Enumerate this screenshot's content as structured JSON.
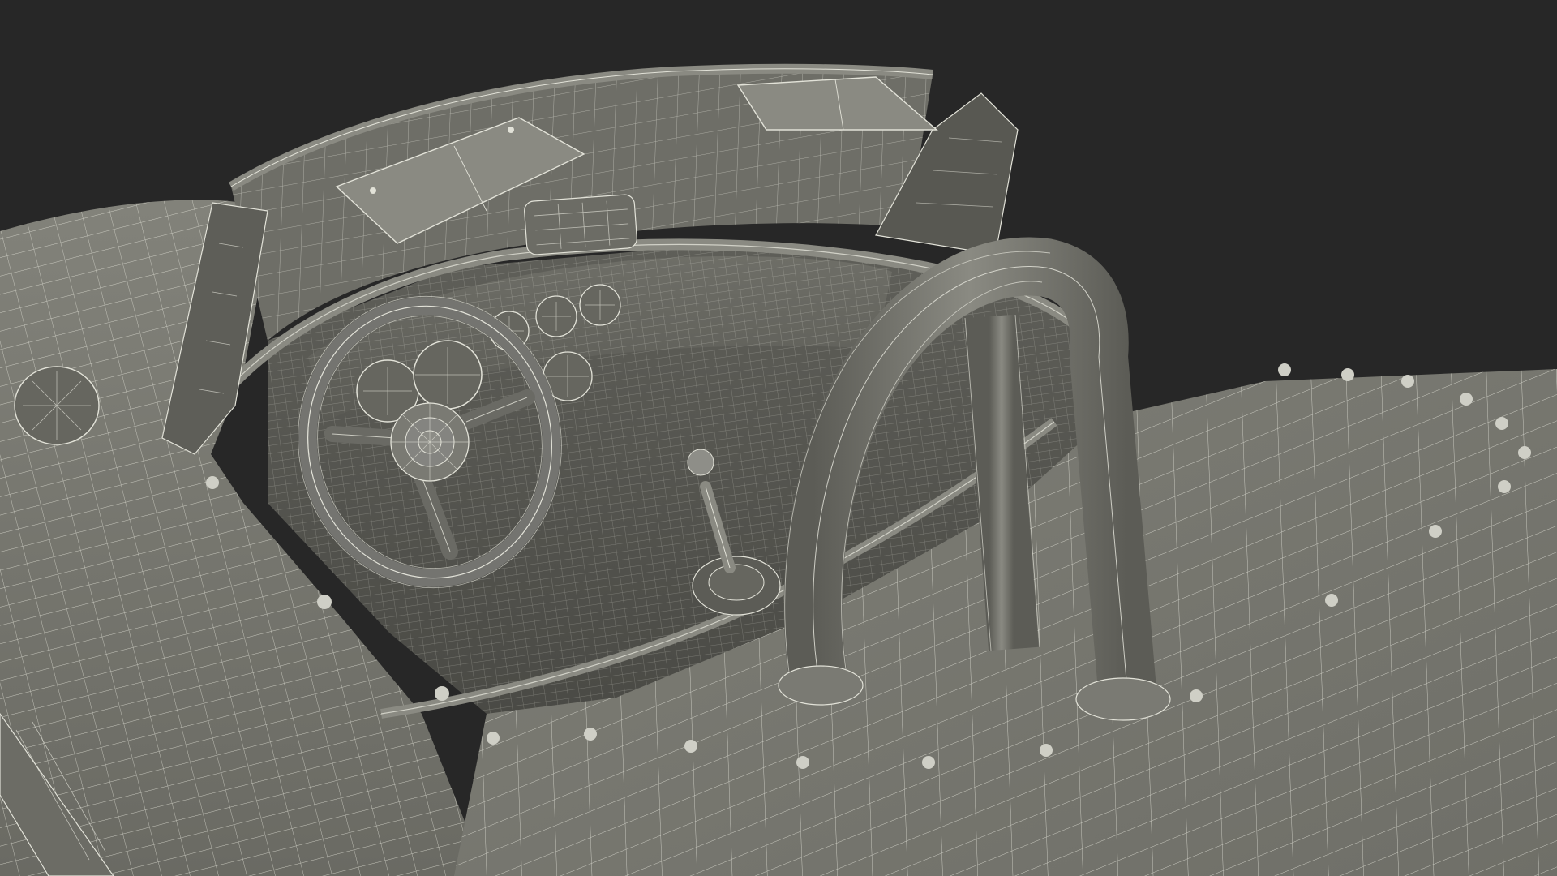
{
  "viewport": {
    "background_color": "#272727",
    "surface_color": "#74746c",
    "surface_dark_color": "#5b5b55",
    "wire_color": "#e6e6dc",
    "shadow_color": "#3c3c38"
  },
  "scene": {
    "subject": "wireframe-roadster-cockpit",
    "render_style": "wireframe-over-shaded"
  }
}
